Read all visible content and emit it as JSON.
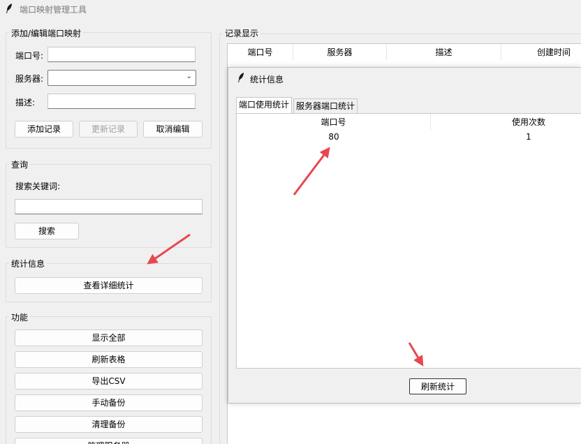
{
  "window": {
    "title": "端口映射管理工具"
  },
  "edit_group": {
    "legend": "添加/编辑端口映射",
    "port_label": "端口号:",
    "server_label": "服务器:",
    "desc_label": "描述:",
    "port_value": "",
    "server_value": "",
    "desc_value": "",
    "add_button": "添加记录",
    "update_button": "更新记录",
    "cancel_button": "取消编辑"
  },
  "query_group": {
    "legend": "查询",
    "keyword_label": "搜索关键词:",
    "keyword_value": "",
    "search_button": "搜索"
  },
  "stats_group": {
    "legend": "统计信息",
    "detail_button": "查看详细统计"
  },
  "functions_group": {
    "legend": "功能",
    "buttons": [
      "显示全部",
      "刷新表格",
      "导出CSV",
      "手动备份",
      "清理备份",
      "管理服务器"
    ]
  },
  "records": {
    "legend": "记录显示",
    "columns": [
      "端口号",
      "服务器",
      "描述",
      "创建时间"
    ]
  },
  "stats_window": {
    "title": "统计信息",
    "tabs": [
      "端口使用统计",
      "服务器端口统计"
    ],
    "active_tab": 0,
    "columns": [
      "端口号",
      "使用次数"
    ],
    "rows": [
      {
        "port": "80",
        "count": "1"
      }
    ],
    "refresh_button": "刷新统计"
  },
  "annotation_color": "#e8474f",
  "icons": {
    "app": "feather-icon",
    "dropdown": "chevron-down-icon"
  }
}
